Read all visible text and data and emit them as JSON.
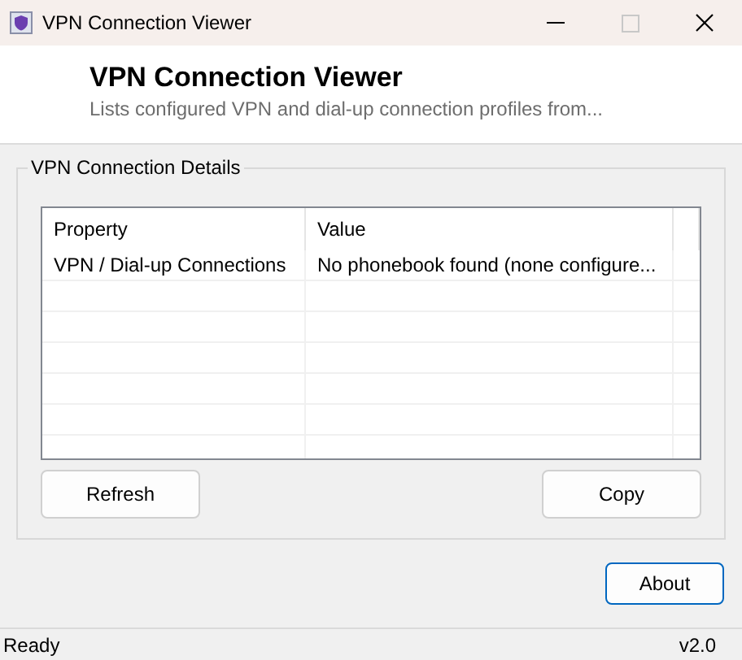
{
  "window": {
    "title": "VPN Connection Viewer",
    "maximize_disabled": true
  },
  "header": {
    "title": "VPN Connection Viewer",
    "subtitle": "Lists configured VPN and dial-up connection profiles from..."
  },
  "group": {
    "title": "VPN Connection Details",
    "table": {
      "columns": [
        "Property",
        "Value"
      ],
      "rows": [
        [
          "VPN / Dial-up Connections",
          "No phonebook found (none configure..."
        ]
      ]
    },
    "buttons": [
      "Refresh",
      "Copy"
    ]
  },
  "about_button": {
    "label": "About",
    "focused": true
  },
  "status_bar": {
    "text": "Ready",
    "version": "v2.0"
  }
}
